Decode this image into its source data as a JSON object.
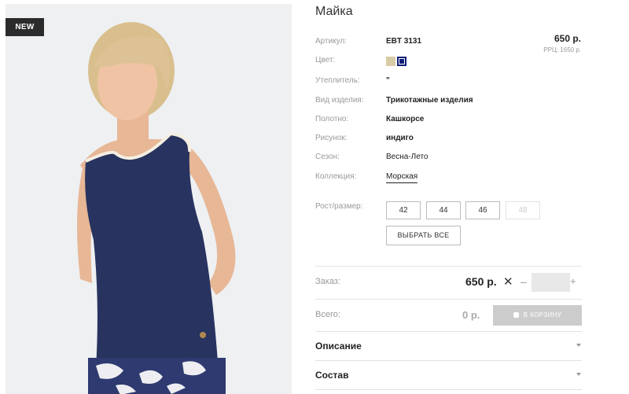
{
  "badge": "NEW",
  "product": {
    "title": "Майка",
    "price": "650 р.",
    "rrp": "РРЦ: 1650 р."
  },
  "specs": [
    {
      "label": "Артикул:",
      "value": "EBT 3131"
    },
    {
      "label": "Цвет:",
      "value": ""
    },
    {
      "label": "Утеплитель:",
      "value": "\""
    },
    {
      "label": "Вид изделия:",
      "value": "Трикотажные изделия"
    },
    {
      "label": "Полотно:",
      "value": "Кашкорсе"
    },
    {
      "label": "Рисунок:",
      "value": "индиго"
    },
    {
      "label": "Сезон:",
      "value": "Весна-Лето"
    },
    {
      "label": "Коллекция:",
      "value": "Морская"
    }
  ],
  "colors": [
    "#d8cba6",
    "#0f1e76"
  ],
  "sizes": {
    "label": "Рост/размер:",
    "options": [
      "42",
      "44",
      "46",
      "48"
    ],
    "select_all": "ВЫБРАТЬ ВСЕ"
  },
  "order": {
    "label": "Заказ:",
    "price": "650 р.",
    "times": "✕",
    "minus": "–",
    "plus": "+"
  },
  "total": {
    "label": "Всего:",
    "value": "0 р.",
    "cart_button": "В КОРЗИНУ"
  },
  "sections": [
    "Описание",
    "Состав"
  ]
}
